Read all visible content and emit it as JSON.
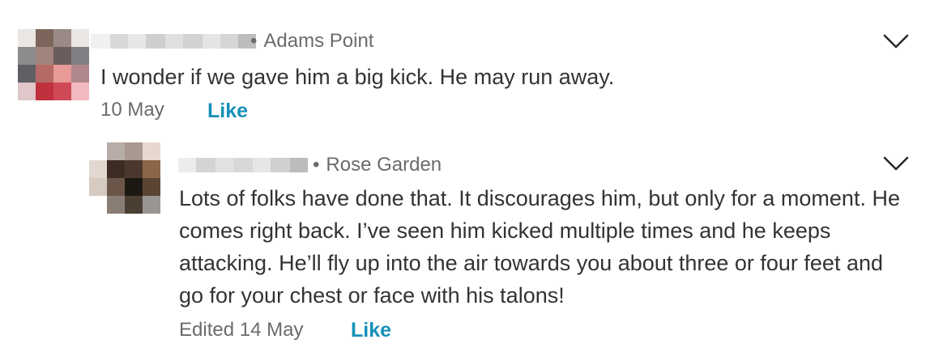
{
  "comments": [
    {
      "neighborhood": "Adams Point",
      "text": "I wonder if we gave him a big kick. He may run away.",
      "date": "10 May",
      "like_label": "Like",
      "avatar_colors": [
        "#e9e6e4",
        "#7d655c",
        "#9a8a85",
        "#ebe7e5",
        "#8c8c8f",
        "#a1847c",
        "#6a5d5b",
        "#7f7f85",
        "#5f5f64",
        "#b56a66",
        "#e79a98",
        "#b0888c",
        "#e0c7ca",
        "#c0303d",
        "#cf4a56",
        "#f2b9bf"
      ]
    },
    {
      "neighborhood": "Rose Garden",
      "text": "Lots of folks have done that.  It discourages him, but only for a moment.  He comes right back.  I’ve seen him kicked  multiple times and he keeps attacking.  He’ll fly up into the air towards you about three or four feet and go for your chest or face with his talons!",
      "date": "Edited 14 May",
      "like_label": "Like",
      "avatar_colors": [
        "#ffffff",
        "#b8aca6",
        "#a99891",
        "#e6d8d0",
        "#e2d8cf",
        "#3d2c23",
        "#4a382e",
        "#8b6647",
        "#d7cac0",
        "#6b5649",
        "#1e1813",
        "#5a4535",
        "#ffffff",
        "#8a7d74",
        "#4b3f34",
        "#9a9592"
      ]
    }
  ]
}
